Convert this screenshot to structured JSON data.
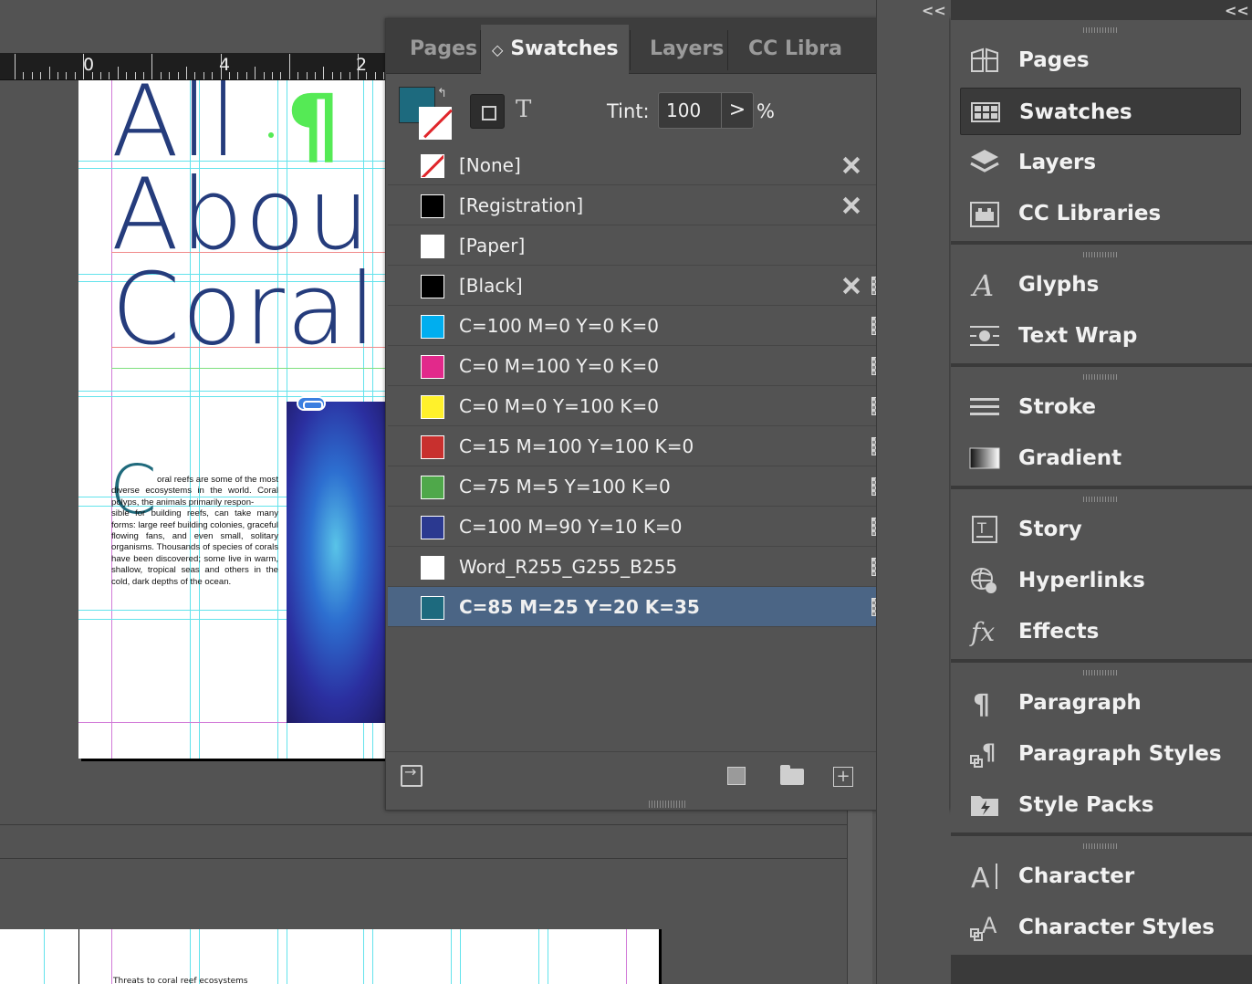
{
  "ruler": {
    "marks": [
      "0",
      "2",
      "4"
    ]
  },
  "document": {
    "headline_lines": [
      "All",
      "Abou",
      "Coral"
    ],
    "pilcrow": "¶",
    "drop_cap": "C",
    "body_first": "oral reefs are some of the most diverse ecosystems in the world. Coral polyps, the animals primarily respon-",
    "body_rest": "sible for building reefs, can take many forms: large reef building colonies, graceful flowing fans, and even small, solitary organisms. Thousands of species of corals have been discovered; some live in warm, shallow, tropical seas and others in the cold, dark depths of the ocean.",
    "page2_text": "Threats to coral reef ecosystems"
  },
  "swatches_panel": {
    "tabs": [
      {
        "label": "Pages",
        "active": false
      },
      {
        "label": "Swatches",
        "active": true
      },
      {
        "label": "Layers",
        "active": false
      },
      {
        "label": "CC Libra",
        "active": false
      }
    ],
    "tab_sort_glyph": "◇",
    "overflow_label": ">>",
    "tint_label": "Tint:",
    "tint_value": "100",
    "tint_arrow": ">",
    "tint_unit": "%",
    "text_mode_glyph": "T",
    "swap_glyph": "↰",
    "fill_color": "#1d6a7e",
    "swatches": [
      {
        "name": "[None]",
        "color": "none",
        "locked": true,
        "process": false,
        "mode": "none"
      },
      {
        "name": "[Registration]",
        "color": "#000000",
        "locked": true,
        "process": false,
        "mode": "registration"
      },
      {
        "name": "[Paper]",
        "color": "#ffffff",
        "locked": false,
        "process": false,
        "mode": ""
      },
      {
        "name": "[Black]",
        "color": "#000000",
        "locked": true,
        "process": true,
        "mode": "cmyk"
      },
      {
        "name": "C=100 M=0 Y=0 K=0",
        "color": "#00aeef",
        "locked": false,
        "process": true,
        "mode": "cmyk"
      },
      {
        "name": "C=0 M=100 Y=0 K=0",
        "color": "#e2298b",
        "locked": false,
        "process": true,
        "mode": "cmyk"
      },
      {
        "name": "C=0 M=0 Y=100 K=0",
        "color": "#fff12b",
        "locked": false,
        "process": true,
        "mode": "cmyk"
      },
      {
        "name": "C=15 M=100 Y=100 K=0",
        "color": "#c8302e",
        "locked": false,
        "process": true,
        "mode": "cmyk"
      },
      {
        "name": "C=75 M=5 Y=100 K=0",
        "color": "#4fa84a",
        "locked": false,
        "process": true,
        "mode": "cmyk"
      },
      {
        "name": "C=100 M=90 Y=10 K=0",
        "color": "#2b3990",
        "locked": false,
        "process": true,
        "mode": "cmyk"
      },
      {
        "name": "Word_R255_G255_B255",
        "color": "#ffffff",
        "locked": false,
        "process": true,
        "mode": "rgb"
      },
      {
        "name": "C=85 M=25 Y=20 K=35",
        "color": "#1d6a7e",
        "locked": false,
        "process": true,
        "mode": "cmyk",
        "selected": true
      }
    ],
    "new_swatch_plus": "+"
  },
  "dock": {
    "collapse_glyph": "<<",
    "groups": [
      {
        "items": [
          {
            "label": "Pages",
            "icon": "pages-icon",
            "active": false
          },
          {
            "label": "Swatches",
            "icon": "swatches-icon",
            "active": true
          },
          {
            "label": "Layers",
            "icon": "layers-icon",
            "active": false
          },
          {
            "label": "CC Libraries",
            "icon": "cc-libraries-icon",
            "active": false
          }
        ]
      },
      {
        "items": [
          {
            "label": "Glyphs",
            "icon": "glyphs-icon",
            "active": false
          },
          {
            "label": "Text Wrap",
            "icon": "text-wrap-icon",
            "active": false
          }
        ]
      },
      {
        "items": [
          {
            "label": "Stroke",
            "icon": "stroke-icon",
            "active": false
          },
          {
            "label": "Gradient",
            "icon": "gradient-icon",
            "active": false
          }
        ]
      },
      {
        "items": [
          {
            "label": "Story",
            "icon": "story-icon",
            "active": false
          },
          {
            "label": "Hyperlinks",
            "icon": "hyperlinks-icon",
            "active": false
          },
          {
            "label": "Effects",
            "icon": "effects-icon",
            "active": false
          }
        ]
      },
      {
        "items": [
          {
            "label": "Paragraph",
            "icon": "paragraph-icon",
            "active": false
          },
          {
            "label": "Paragraph Styles",
            "icon": "paragraph-styles-icon",
            "active": false
          },
          {
            "label": "Style Packs",
            "icon": "style-packs-icon",
            "active": false
          }
        ]
      },
      {
        "items": [
          {
            "label": "Character",
            "icon": "character-icon",
            "active": false
          },
          {
            "label": "Character Styles",
            "icon": "character-styles-icon",
            "active": false
          }
        ]
      }
    ]
  }
}
